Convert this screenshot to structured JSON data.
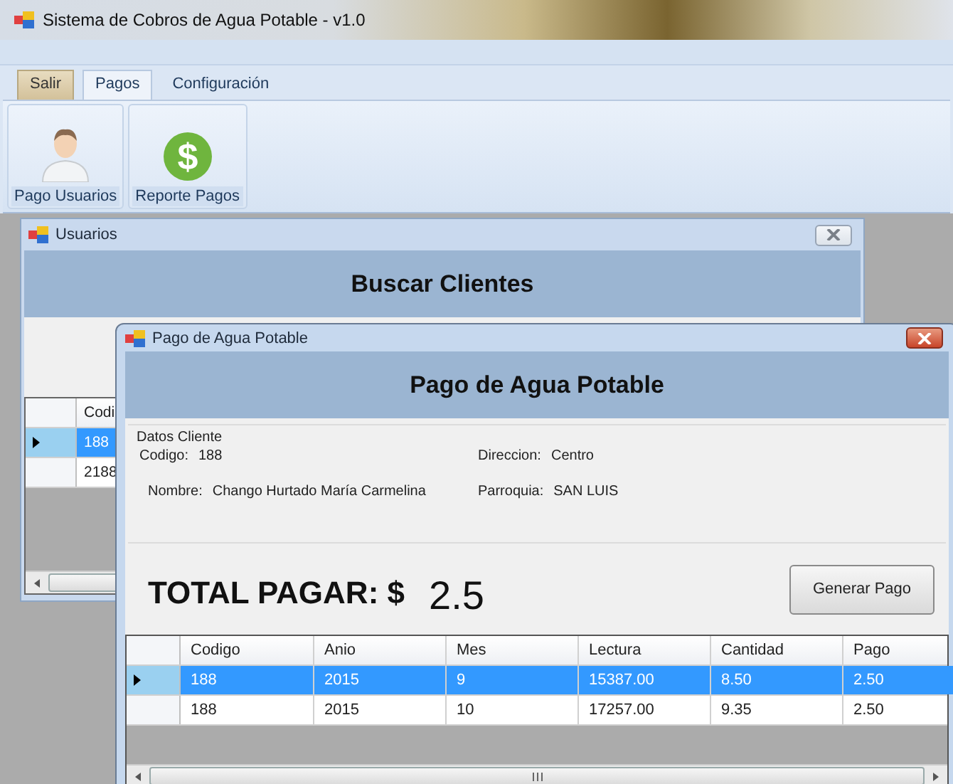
{
  "app_window": {
    "title": "Sistema de Cobros de Agua Potable - v1.0"
  },
  "ribbon": {
    "tabs": [
      {
        "label": "Salir",
        "selected": false,
        "kind": "file"
      },
      {
        "label": "Pagos",
        "selected": true,
        "kind": "tab"
      },
      {
        "label": "Configuración",
        "selected": false,
        "kind": "tab"
      }
    ],
    "buttons": [
      {
        "label": "Pago Usuarios",
        "kind": "user"
      },
      {
        "label": "Reporte Pagos",
        "kind": "coin",
        "glyph": "$"
      }
    ]
  },
  "usuarios_window": {
    "title": "Usuarios",
    "header": "Buscar Clientes",
    "grid": {
      "columns": [
        "Codi"
      ],
      "rows": [
        {
          "cells": [
            "188"
          ],
          "selected": true
        },
        {
          "cells": [
            "2188"
          ],
          "selected": false
        }
      ]
    }
  },
  "pago_window": {
    "title": "Pago de Agua Potable",
    "header": "Pago de Agua Potable",
    "group": {
      "title": "Datos Cliente",
      "fields": [
        {
          "label": "Codigo:",
          "value": "188"
        },
        {
          "label": "Direccion:",
          "value": "Centro"
        },
        {
          "label": "Nombre:",
          "value": "Chango Hurtado María Carmelina"
        },
        {
          "label": "Parroquia:",
          "value": "SAN LUIS"
        }
      ]
    },
    "total_label": "TOTAL PAGAR: $",
    "total_value": "2.5",
    "button": "Generar Pago",
    "grid": {
      "columns": [
        "Codigo",
        "Anio",
        "Mes",
        "Lectura",
        "Cantidad",
        "Pago"
      ],
      "rows": [
        {
          "cells": [
            "188",
            "2015",
            "9",
            "15387.00",
            "8.50",
            "2.50"
          ],
          "selected": true
        },
        {
          "cells": [
            "188",
            "2015",
            "10",
            "17257.00",
            "9.35",
            "2.50"
          ],
          "selected": false
        }
      ]
    }
  }
}
